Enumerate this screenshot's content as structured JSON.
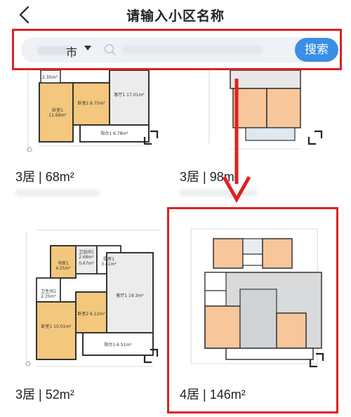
{
  "header": {
    "title": "请输入小区名称"
  },
  "search": {
    "city_label": "市",
    "placeholder": "",
    "button_label": "搜索"
  },
  "listings": [
    {
      "layout_label": "3居 | 68m²",
      "rooms": [
        "卧室1 11.69m²",
        "卧室2 8.75m²",
        "客厅1 17.01m²",
        "阳台1 6.78m²",
        "2.35m²"
      ]
    },
    {
      "layout_label": "3居 | 98m²"
    },
    {
      "layout_label": "3居 | 52m²",
      "rooms": [
        "书房1 4.25m²",
        "卫生间1 2.35m²",
        "卧室1 10.01m²",
        "卧室2 6.12m²",
        "客厅1 19.3m²",
        "厨房1 3.41m²",
        "阳台1 6.51m²",
        "卫浴间1 2.68m²",
        "0.67m²"
      ]
    },
    {
      "layout_label": "4居 | 146m²"
    }
  ],
  "colors": {
    "accent": "#3a8ee6",
    "annotation": "#e02020"
  }
}
